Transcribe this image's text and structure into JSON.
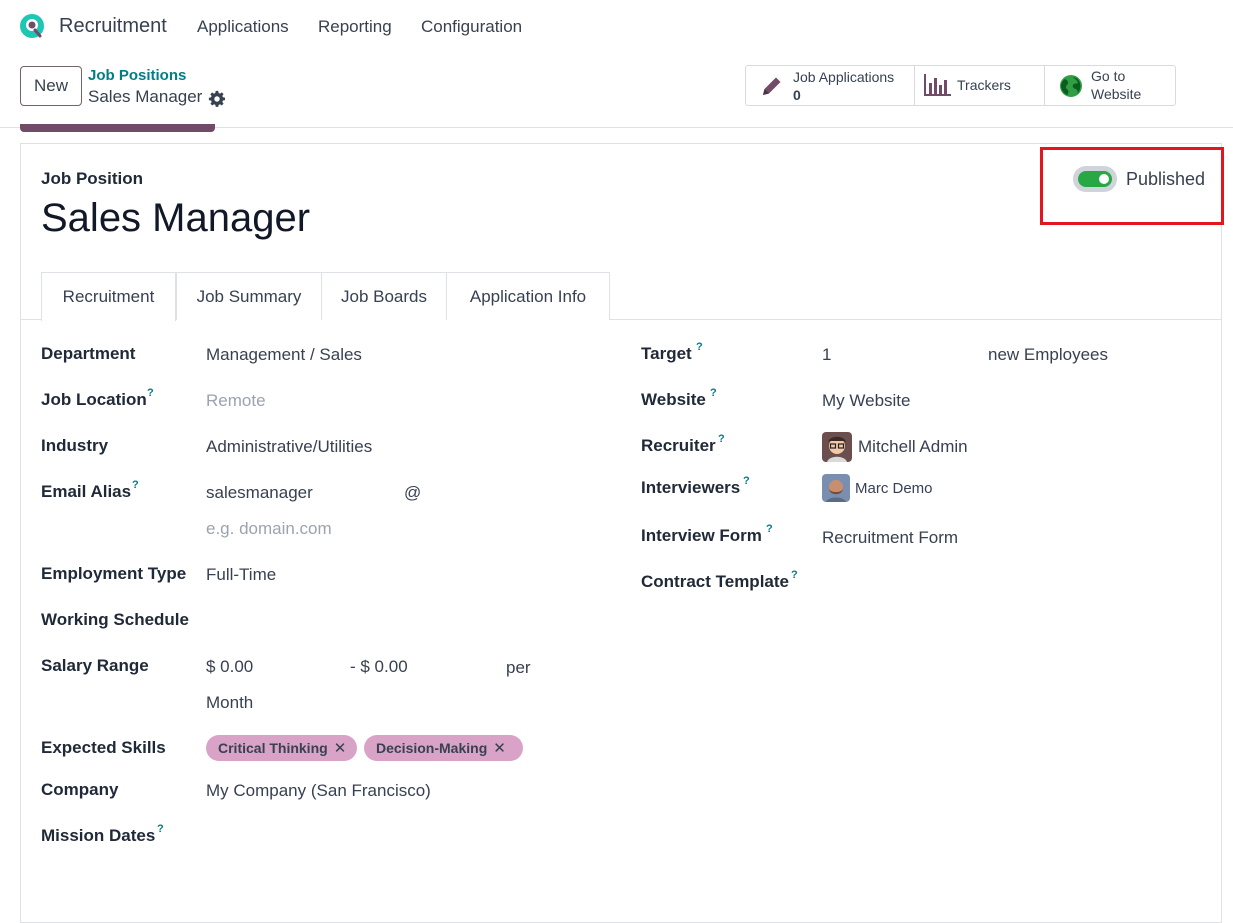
{
  "app": {
    "title": "Recruitment",
    "menu": [
      "Applications",
      "Reporting",
      "Configuration"
    ]
  },
  "control": {
    "new_label": "New",
    "breadcrumb_parent": "Job Positions",
    "breadcrumb_current": "Sales Manager",
    "smart_buttons": {
      "job_applications_label": "Job Applications",
      "job_applications_count": "0",
      "trackers_label": "Trackers",
      "website_line1": "Go to",
      "website_line2": "Website"
    }
  },
  "form": {
    "section_label": "Job Position",
    "name": "Sales Manager",
    "published_label": "Published",
    "published": true,
    "tabs": [
      "Recruitment",
      "Job Summary",
      "Job Boards",
      "Application Info"
    ],
    "active_tab": "Recruitment",
    "left": {
      "department_label": "Department",
      "department": "Management / Sales",
      "job_location_label": "Job Location",
      "job_location_placeholder": "Remote",
      "industry_label": "Industry",
      "industry": "Administrative/Utilities",
      "email_alias_label": "Email Alias",
      "email_alias": "salesmanager",
      "email_at": "@",
      "email_domain_placeholder": "e.g. domain.com",
      "employment_type_label": "Employment Type",
      "employment_type": "Full-Time",
      "working_schedule_label": "Working Schedule",
      "salary_range_label": "Salary Range",
      "salary_min": "$ 0.00",
      "salary_max": "- $ 0.00",
      "salary_per": "per",
      "salary_period": "Month",
      "expected_skills_label": "Expected Skills",
      "skills": [
        "Critical Thinking",
        "Decision-Making"
      ],
      "company_label": "Company",
      "company": "My Company (San Francisco)",
      "mission_dates_label": "Mission Dates"
    },
    "right": {
      "target_label": "Target",
      "target": "1",
      "target_suffix": "new Employees",
      "website_label": "Website",
      "website": "My Website",
      "recruiter_label": "Recruiter",
      "recruiter": "Mitchell Admin",
      "interviewers_label": "Interviewers",
      "interviewer": "Marc Demo",
      "interview_form_label": "Interview Form",
      "interview_form": "Recruitment Form",
      "contract_template_label": "Contract Template"
    },
    "help_mark": "?"
  },
  "colors": {
    "brand": "#714b67",
    "link": "#017e84",
    "toggle_on": "#28a745",
    "tag": "#d9a3c7",
    "highlight": "#e3161f"
  },
  "icons": [
    "app-logo-icon",
    "gear-icon",
    "pencil-icon",
    "bar-chart-icon",
    "globe-icon",
    "close-icon"
  ]
}
